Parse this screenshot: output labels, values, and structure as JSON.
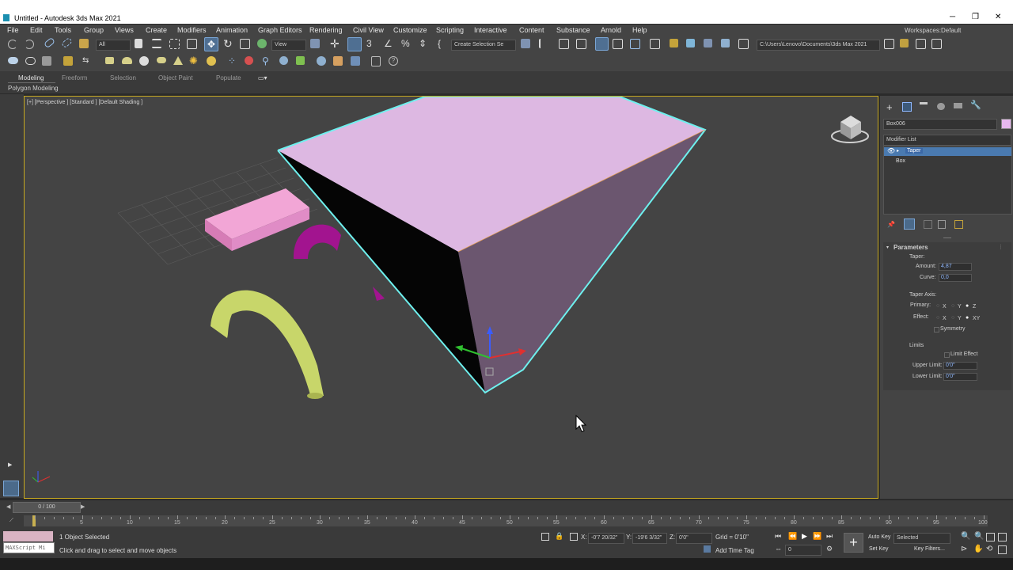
{
  "window": {
    "title": "Untitled - Autodesk 3ds Max 2021"
  },
  "menu": [
    "File",
    "Edit",
    "Tools",
    "Group",
    "Views",
    "Create",
    "Modifiers",
    "Animation",
    "Graph Editors",
    "Rendering",
    "Civil View",
    "Customize",
    "Scripting",
    "Interactive",
    "Content",
    "Substance",
    "Arnold",
    "Help"
  ],
  "workspace": {
    "label": "Workspaces:",
    "value": "Default"
  },
  "toolbar": {
    "filter": "All",
    "view": "View",
    "selection_set": "Create Selection Se",
    "path": "C:\\Users\\Lenovo\\Documents\\3ds Max 2021"
  },
  "ribbon": {
    "tabs": [
      "Modeling",
      "Freeform",
      "Selection",
      "Object Paint",
      "Populate"
    ],
    "active": "Modeling",
    "sub": "Polygon Modeling"
  },
  "viewport": {
    "label": "[+] [Perspective ] [Standard ] [Default Shading ]"
  },
  "panel": {
    "object_name": "Box006",
    "object_color": "#e7b8ef",
    "modifier_list": "Modifier List",
    "stack": [
      "Taper",
      "Box"
    ],
    "rollout": "Parameters",
    "taper_label": "Taper:",
    "amount_label": "Amount:",
    "amount": "4,87",
    "curve_label": "Curve:",
    "curve": "0,0",
    "taper_axis": "Taper Axis:",
    "primary": "Primary:",
    "effect": "Effect:",
    "x": "X",
    "y": "Y",
    "z": "Z",
    "xy": "XY",
    "symmetry": "Symmetry",
    "limits": "Limits",
    "limit_effect": "Limit Effect",
    "upper_label": "Upper Limit:",
    "upper": "0'0\"",
    "lower_label": "Lower Limit:",
    "lower": "0'0\""
  },
  "timeline": {
    "frame": "0 / 100",
    "ticks": [
      "5",
      "10",
      "15",
      "20",
      "25",
      "30",
      "35",
      "40",
      "45",
      "50",
      "55",
      "60",
      "65",
      "70",
      "75",
      "80",
      "85",
      "90",
      "95",
      "100"
    ]
  },
  "status": {
    "maxscript": "MAXScript Mi",
    "selected": "1 Object Selected",
    "prompt": "Click and drag to select and move objects",
    "x_label": "X:",
    "x": "-0'7 20/32\"",
    "y_label": "Y:",
    "y": "-19'6 3/32\"",
    "z_label": "Z:",
    "z": "0'0\"",
    "grid": "Grid = 0'10\"",
    "add_time_tag": "Add Time Tag",
    "auto_key": "Auto Key",
    "set_key": "Set Key",
    "selected_dd": "Selected",
    "key_filters": "Key Filters...",
    "frame_field": "0"
  }
}
